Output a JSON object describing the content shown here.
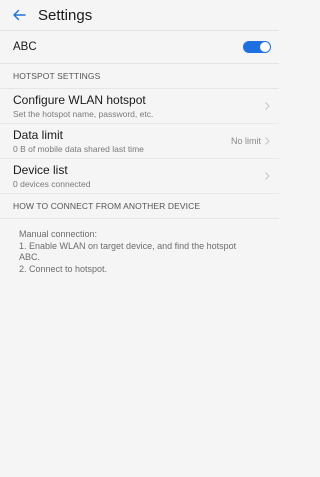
{
  "header": {
    "title": "Settings",
    "back_icon": "arrow-left-icon"
  },
  "toggle_row": {
    "label": "ABC",
    "state": "on",
    "accent_color": "#1e6fe0"
  },
  "sections": {
    "hotspot_settings": "HOTSPOT SETTINGS",
    "how_to_connect": "HOW TO CONNECT FROM ANOTHER DEVICE"
  },
  "items": {
    "configure": {
      "title": "Configure WLAN hotspot",
      "subtitle": "Set the hotspot name, password, etc."
    },
    "data_limit": {
      "title": "Data limit",
      "subtitle": "0 B of mobile data shared last time",
      "value": "No limit"
    },
    "device_list": {
      "title": "Device list",
      "subtitle": "0 devices connected"
    }
  },
  "howto": {
    "line1": "Manual connection:",
    "line2": "1. Enable WLAN on target device, and find the hotspot",
    "line3": "ABC.",
    "line4": "2. Connect to hotspot."
  }
}
